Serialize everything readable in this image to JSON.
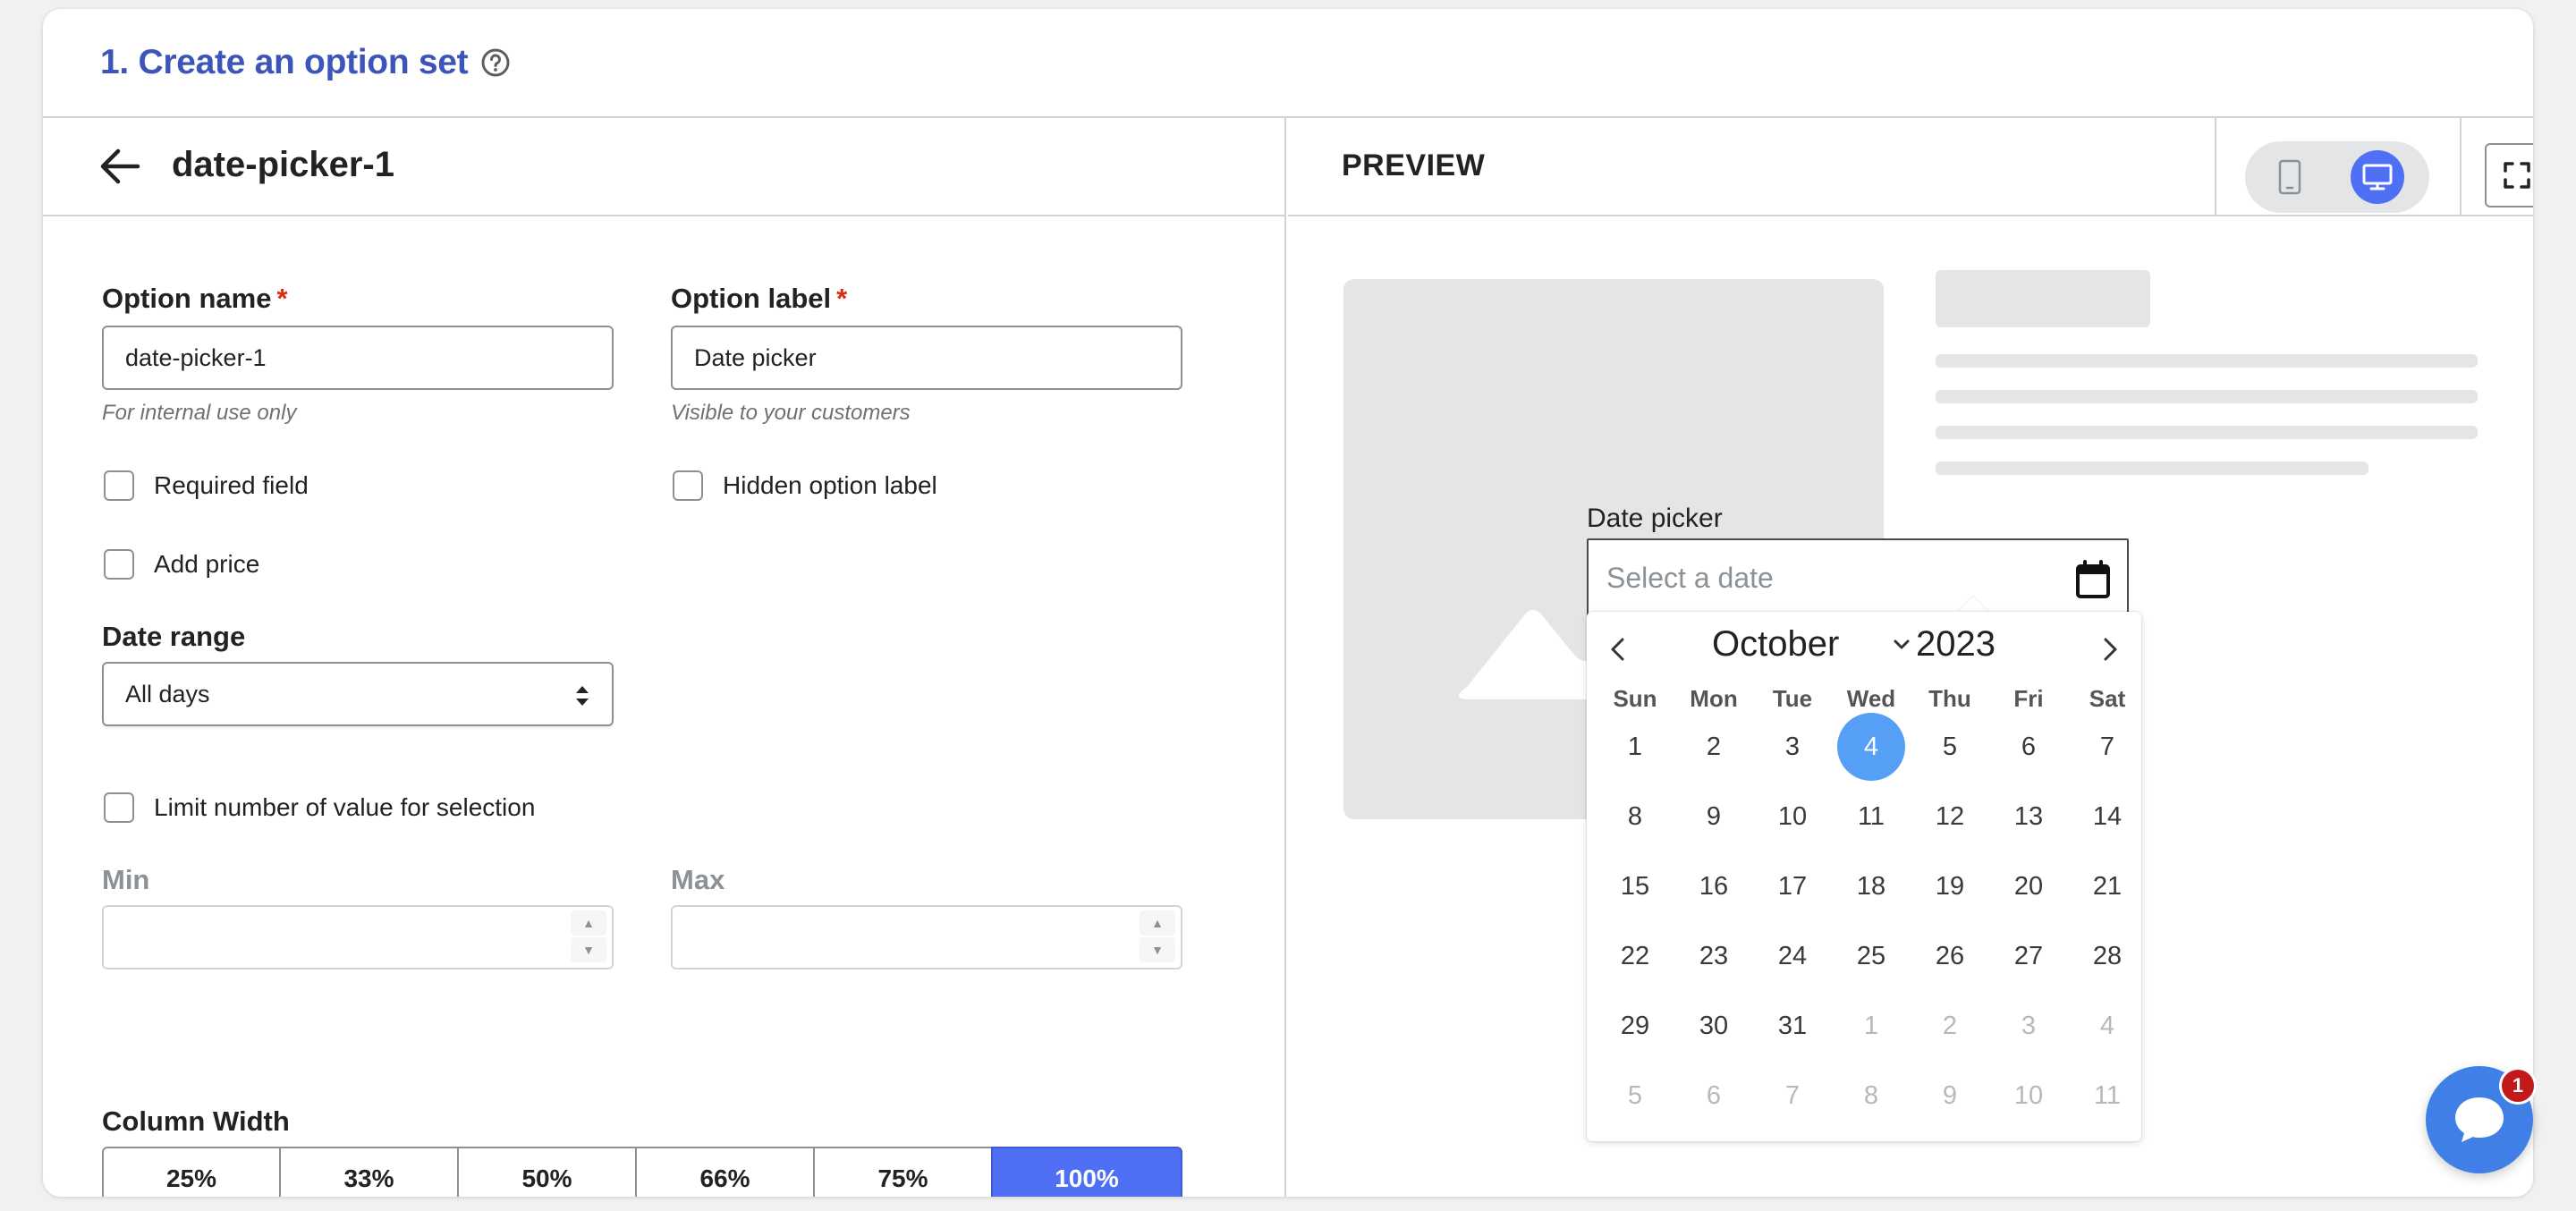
{
  "header": {
    "title": "1. Create an option set",
    "help_icon": "question-circle-icon"
  },
  "editor": {
    "back_icon": "arrow-left-icon",
    "option_title": "date-picker-1",
    "option_name": {
      "label": "Option name",
      "required_mark": "*",
      "value": "date-picker-1",
      "help": "For internal use only"
    },
    "option_label": {
      "label": "Option label",
      "required_mark": "*",
      "value": "Date picker",
      "help": "Visible to your customers"
    },
    "checkboxes": {
      "required_field": "Required field",
      "hidden_option_label": "Hidden option label",
      "add_price": "Add price",
      "limit_selection": "Limit number of value for selection"
    },
    "date_range": {
      "label": "Date range",
      "selected": "All days"
    },
    "min": {
      "label": "Min",
      "value": ""
    },
    "max": {
      "label": "Max",
      "value": ""
    },
    "column_width": {
      "label": "Column Width",
      "options": [
        "25%",
        "33%",
        "50%",
        "66%",
        "75%",
        "100%"
      ],
      "selected": "100%"
    }
  },
  "preview": {
    "label": "PREVIEW",
    "device_icons": [
      "mobile-icon",
      "desktop-icon"
    ],
    "active_device": "desktop",
    "fullscreen_icon": "expand-icon",
    "image_icon": "image-placeholder-icon",
    "date_picker": {
      "label": "Date picker",
      "placeholder": "Select a date",
      "calendar_icon": "calendar-icon"
    },
    "calendar": {
      "month": "October",
      "year": "2023",
      "weekdays": [
        "Sun",
        "Mon",
        "Tue",
        "Wed",
        "Thu",
        "Fri",
        "Sat"
      ],
      "selected_day": "4",
      "days": [
        [
          "1",
          "2",
          "3",
          "4",
          "5",
          "6",
          "7"
        ],
        [
          "8",
          "9",
          "10",
          "11",
          "12",
          "13",
          "14"
        ],
        [
          "15",
          "16",
          "17",
          "18",
          "19",
          "20",
          "21"
        ],
        [
          "22",
          "23",
          "24",
          "25",
          "26",
          "27",
          "28"
        ],
        [
          "29",
          "30",
          "31",
          "1",
          "2",
          "3",
          "4"
        ],
        [
          "5",
          "6",
          "7",
          "8",
          "9",
          "10",
          "11"
        ]
      ]
    },
    "accent_color": "#4f6ff4",
    "selected_day_color": "#569ff7"
  },
  "chat": {
    "icon": "chat-bubble-icon",
    "badge": "1"
  }
}
